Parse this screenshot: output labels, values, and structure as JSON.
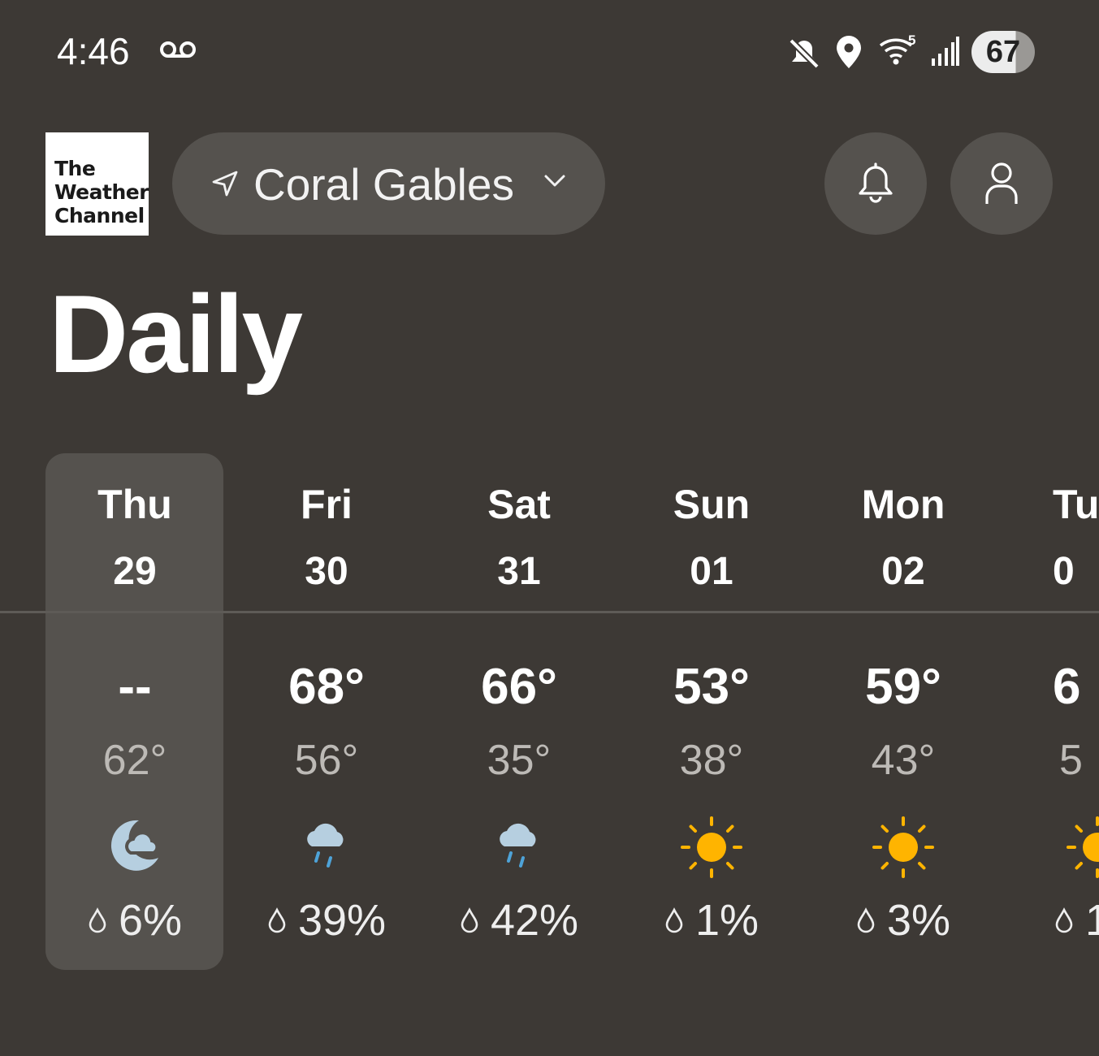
{
  "status_bar": {
    "time": "4:46",
    "battery": "67",
    "icons": [
      "voicemail-icon",
      "mute-icon",
      "location-icon",
      "wifi-icon",
      "signal-icon",
      "battery-icon"
    ]
  },
  "header": {
    "logo_lines": [
      "The",
      "Weather",
      "Channel"
    ],
    "location": "Coral Gables"
  },
  "page_title": "Daily",
  "days": [
    {
      "dow": "Thu",
      "date": "29",
      "high": "--",
      "low": "62°",
      "icon": "night-cloud-icon",
      "precip": "6%"
    },
    {
      "dow": "Fri",
      "date": "30",
      "high": "68°",
      "low": "56°",
      "icon": "rain-icon",
      "precip": "39%"
    },
    {
      "dow": "Sat",
      "date": "31",
      "high": "66°",
      "low": "35°",
      "icon": "rain-icon",
      "precip": "42%"
    },
    {
      "dow": "Sun",
      "date": "01",
      "high": "53°",
      "low": "38°",
      "icon": "sun-icon",
      "precip": "1%"
    },
    {
      "dow": "Mon",
      "date": "02",
      "high": "59°",
      "low": "43°",
      "icon": "sun-icon",
      "precip": "3%"
    },
    {
      "dow": "Tu",
      "date": "0",
      "high": "6",
      "low": "5",
      "icon": "sun-icon",
      "precip": "1"
    }
  ],
  "colors": {
    "background": "#3d3935",
    "surface": "#55524e",
    "sun": "#ffb400",
    "rain_cloud": "#b6cfe0",
    "rain_drop": "#4ea3d8"
  }
}
